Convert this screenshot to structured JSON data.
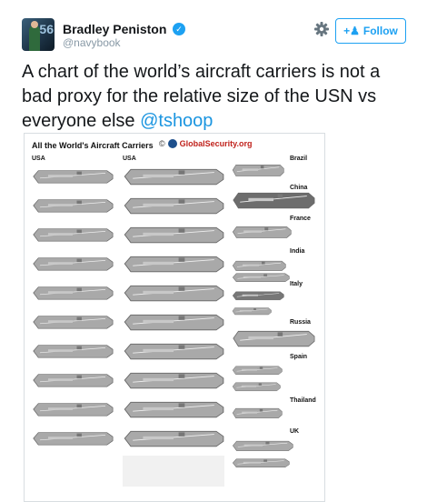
{
  "author": {
    "name": "Bradley Peniston",
    "handle": "@navybook",
    "avatar_label": "56"
  },
  "follow": {
    "label": "Follow"
  },
  "tweet": {
    "text": "A chart of the world’s aircraft carriers is not a bad proxy for the relative size of the USN vs everyone else ",
    "mention": "@tshoop"
  },
  "chart": {
    "title": "All the World's Aircraft Carriers",
    "copyright": "©",
    "logo": "GlobalSecurity.org",
    "left_col_label": "USA",
    "mid_col_label": "USA",
    "countries": [
      "Brazil",
      "China",
      "France",
      "India",
      "Italy",
      "Russia",
      "Spain",
      "Thailand",
      "UK"
    ]
  },
  "colors": {
    "accent": "#1da1f2",
    "link": "#1b95e0",
    "ship_gray": "#a9a9a9",
    "ship_dark": "#555555"
  }
}
